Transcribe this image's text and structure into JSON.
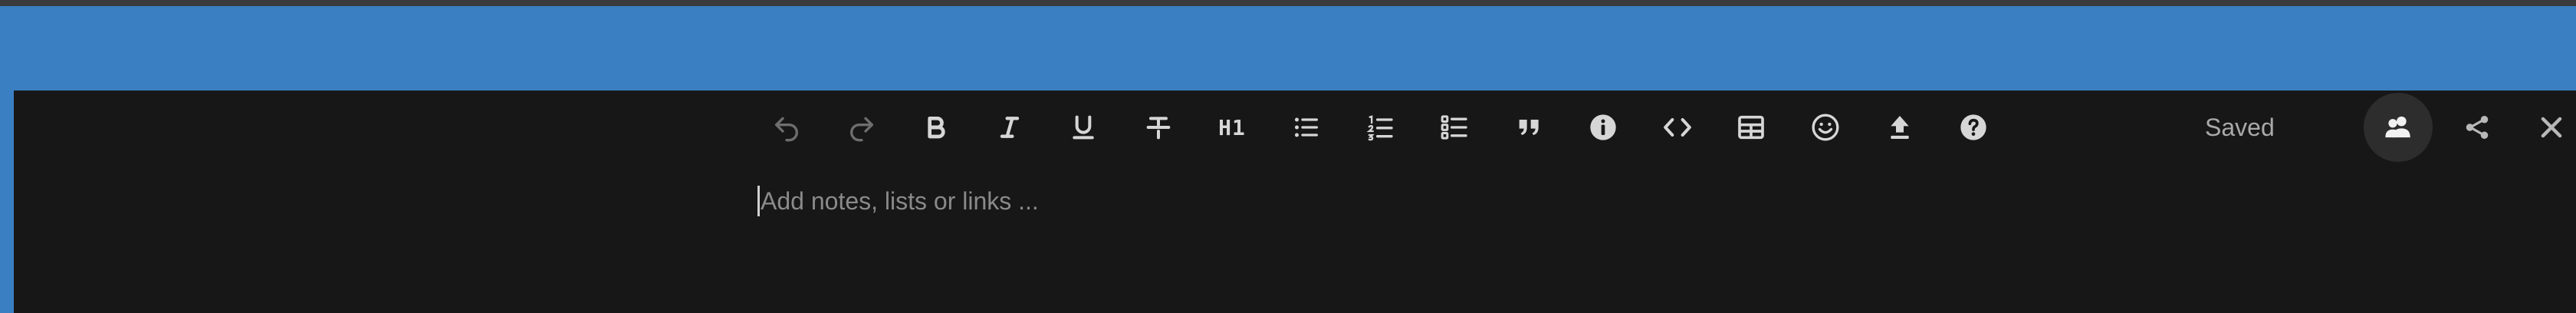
{
  "toolbar": {
    "buttons": [
      {
        "icon": "undo-icon",
        "disabled": true
      },
      {
        "icon": "redo-icon",
        "disabled": true
      },
      {
        "icon": "bold-icon"
      },
      {
        "icon": "italic-icon"
      },
      {
        "icon": "underline-icon"
      },
      {
        "icon": "strikethrough-icon"
      },
      {
        "icon": "heading-icon",
        "label": "H1"
      },
      {
        "icon": "bullet-list-icon"
      },
      {
        "icon": "numbered-list-icon"
      },
      {
        "icon": "checklist-icon"
      },
      {
        "icon": "quote-icon"
      },
      {
        "icon": "info-icon"
      },
      {
        "icon": "code-icon"
      },
      {
        "icon": "table-icon"
      },
      {
        "icon": "emoji-icon"
      },
      {
        "icon": "upload-icon"
      },
      {
        "icon": "help-icon"
      }
    ],
    "heading_label": "H1"
  },
  "status": {
    "saved_text": "Saved"
  },
  "actions": {
    "collaborate_icon": "users-icon",
    "share_icon": "share-icon",
    "close_icon": "close-icon"
  },
  "editor": {
    "placeholder": "Add notes, lists or links ..."
  },
  "colors": {
    "frame_blue": "#3a7fc2",
    "panel_bg": "#171717",
    "icon": "#d6d6d6",
    "icon_disabled": "#6e6e6e",
    "placeholder": "#8a8a8a"
  }
}
